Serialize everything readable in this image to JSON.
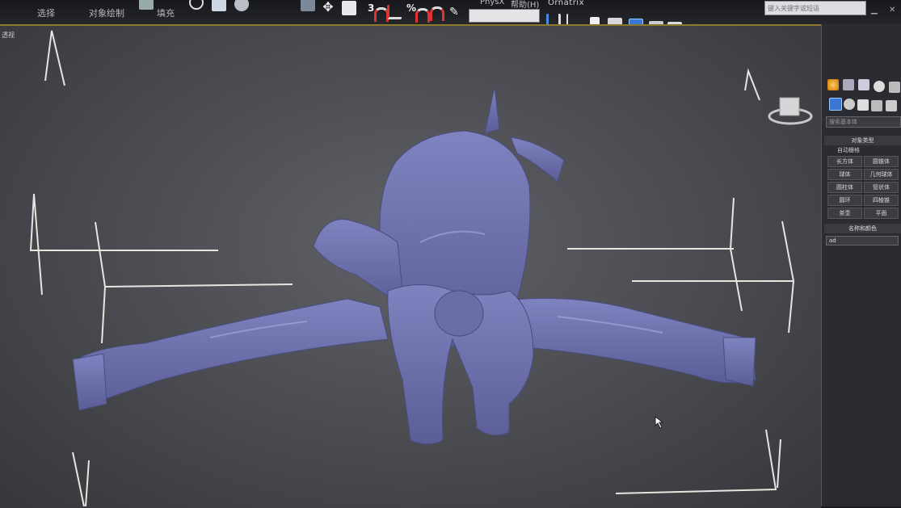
{
  "menubar": {
    "items": [
      "选择",
      "对象绘制",
      "填充"
    ],
    "plugins": "PhysX",
    "help": "帮助(H)",
    "ornatrix": "Ornatrix",
    "search_placeholder": "键入关键字或短语"
  },
  "toolbar": {
    "snap_number": "3",
    "percent_snap": "%",
    "named_selection_value": ""
  },
  "viewport": {
    "corner_label": "透视"
  },
  "command_panel": {
    "search_placeholder": "搜索基本体",
    "object_type_title": "对象类型",
    "autogrid_label": "自动栅格",
    "buttons": [
      "长方体",
      "圆锥体",
      "球体",
      "几何球体",
      "圆柱体",
      "管状体",
      "圆环",
      "四棱锥",
      "茶壶",
      "平面"
    ],
    "name_color_title": "名称和颜色",
    "name_value": "ad"
  },
  "colors": {
    "model": "#6b6fa8",
    "viewport_bg": "#4d4e53",
    "gizmo_lines": "#e6e6e0",
    "active_border": "#8c7a2a"
  }
}
